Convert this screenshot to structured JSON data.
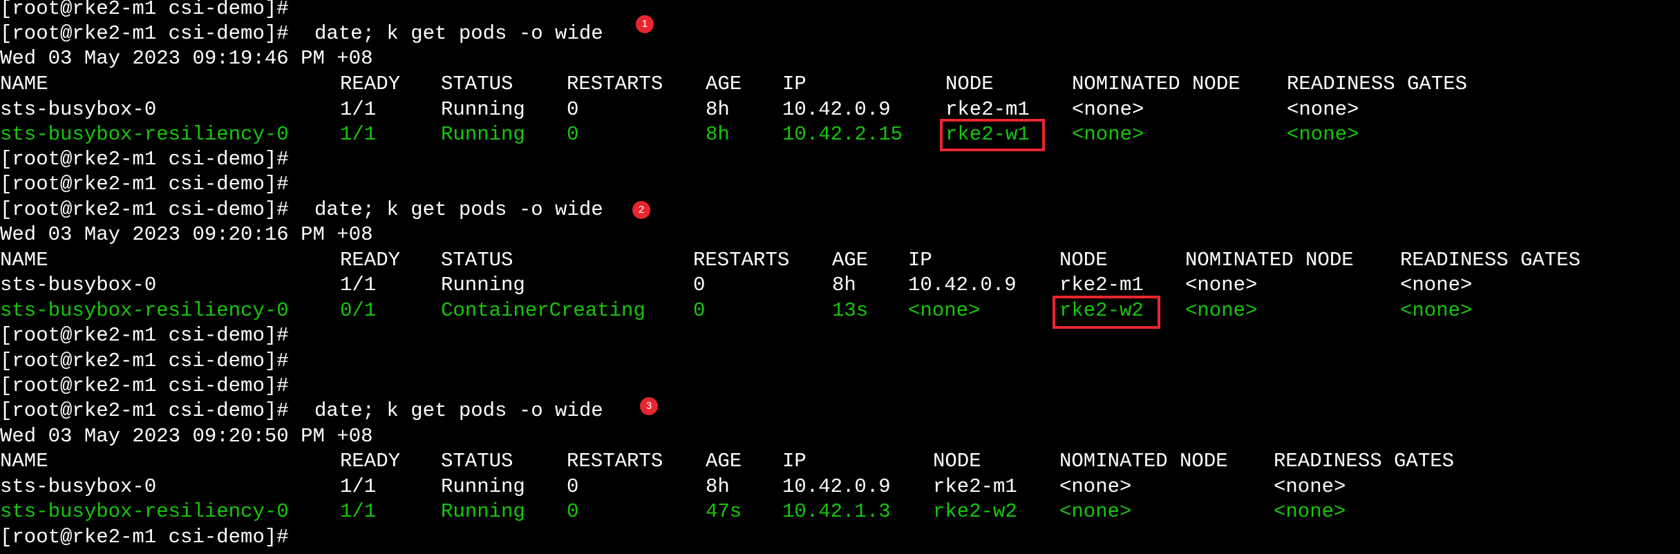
{
  "terminal": {
    "blocks": [
      {
        "command": "date; k get pods -o wide",
        "badge": "1",
        "date": "Wed 03 May 2023 09:19:46 PM +08",
        "headers": [
          "NAME",
          "READY",
          "STATUS",
          "RESTARTS",
          "AGE",
          "IP",
          "NODE",
          "NOMINATED NODE",
          "READINESS GATES"
        ],
        "rows": [
          [
            "sts-busybox-0",
            "1/1",
            "Running",
            "0",
            "8h",
            "10.42.0.9",
            "rke2-m1",
            "<none>",
            "<none>"
          ],
          [
            "sts-busybox-resiliency-0",
            "1/1",
            "Running",
            "0",
            "8h",
            "10.42.2.15",
            "rke2-w1",
            "<none>",
            "<none>"
          ]
        ]
      },
      {
        "command": "date; k get pods -o wide",
        "badge": "2",
        "date": "Wed 03 May 2023 09:20:16 PM +08",
        "headers": [
          "NAME",
          "READY",
          "STATUS",
          "RESTARTS",
          "AGE",
          "IP",
          "NODE",
          "NOMINATED NODE",
          "READINESS GATES"
        ],
        "rows": [
          [
            "sts-busybox-0",
            "1/1",
            "Running",
            "0",
            "8h",
            "10.42.0.9",
            "rke2-m1",
            "<none>",
            "<none>"
          ],
          [
            "sts-busybox-resiliency-0",
            "0/1",
            "ContainerCreating",
            "0",
            "13s",
            "<none>",
            "rke2-w2",
            "<none>",
            "<none>"
          ]
        ]
      },
      {
        "command": "date; k get pods -o wide",
        "badge": "3",
        "date": "Wed 03 May 2023 09:20:50 PM +08",
        "headers": [
          "NAME",
          "READY",
          "STATUS",
          "RESTARTS",
          "AGE",
          "IP",
          "NODE",
          "NOMINATED NODE",
          "READINESS GATES"
        ],
        "rows": [
          [
            "sts-busybox-0",
            "1/1",
            "Running",
            "0",
            "8h",
            "10.42.0.9",
            "rke2-m1",
            "<none>",
            "<none>"
          ],
          [
            "sts-busybox-resiliency-0",
            "1/1",
            "Running",
            "0",
            "47s",
            "10.42.1.3",
            "rke2-w2",
            "<none>",
            "<none>"
          ]
        ]
      }
    ],
    "prompt": "[root@rke2-m1 csi-demo]#",
    "colors": {
      "background": "#000000",
      "text": "#ffffff",
      "highlight_row": "#16c60c",
      "annotation": "#e8262f"
    }
  }
}
